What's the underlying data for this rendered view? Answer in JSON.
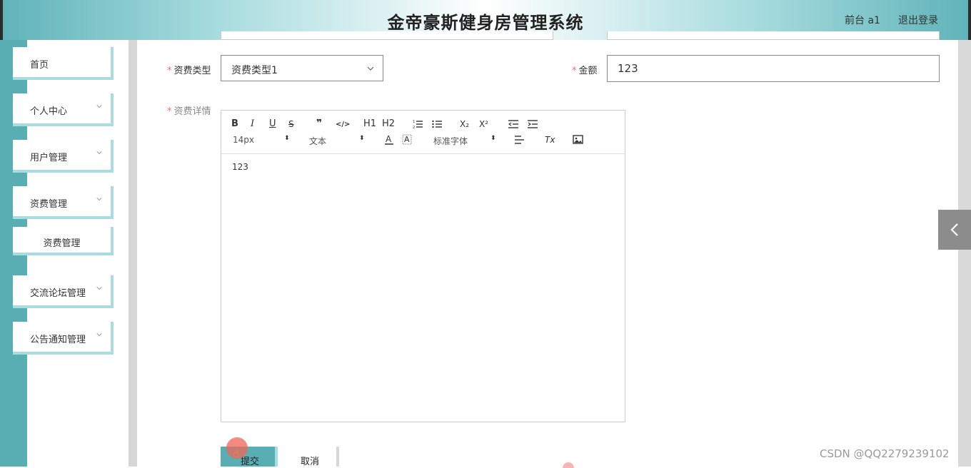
{
  "header": {
    "title": "金帝豪斯健身房管理系统",
    "front_link": "前台 a1",
    "logout_link": "退出登录"
  },
  "sidebar": {
    "items": [
      {
        "label": "首页",
        "expandable": false
      },
      {
        "label": "个人中心",
        "expandable": true
      },
      {
        "label": "用户管理",
        "expandable": true
      },
      {
        "label": "资费管理",
        "expandable": true,
        "expanded": true
      },
      {
        "label": "交流论坛管理",
        "expandable": true
      },
      {
        "label": "公告通知管理",
        "expandable": true
      }
    ],
    "submenu_label": "资费管理"
  },
  "form": {
    "type_label": "资费类型",
    "type_value": "资费类型1",
    "amount_label": "金额",
    "amount_value": "123",
    "detail_label": "资费详情",
    "detail_content": "123"
  },
  "editor_toolbar": {
    "bold": "B",
    "italic": "I",
    "underline": "U",
    "strike": "S",
    "quote": "❞",
    "code": "</>",
    "h1": "H1",
    "h2": "H2",
    "sub": "X₂",
    "sup": "X²",
    "font_size": "14px",
    "text_style": "文本",
    "font_family": "标准字体",
    "clean": "Tx"
  },
  "buttons": {
    "submit": "提交",
    "cancel": "取消"
  },
  "watermark": "CSDN @QQ2279239102",
  "colors": {
    "teal": "#59aeb3",
    "teal_light": "#a7dde1",
    "required": "#f56c6c"
  }
}
